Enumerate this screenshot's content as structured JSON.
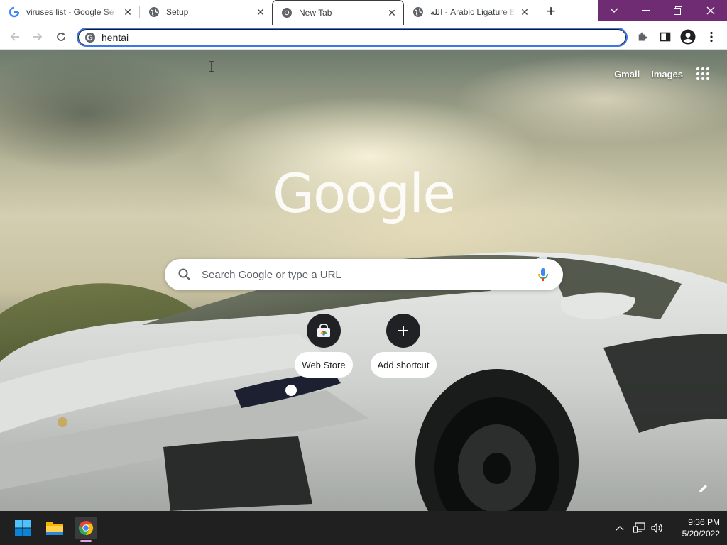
{
  "tabs": [
    {
      "title": "viruses list - Google Se",
      "favicon": "google-g-icon",
      "active": false
    },
    {
      "title": "Setup",
      "favicon": "globe-icon",
      "active": false
    },
    {
      "title": "New Tab",
      "favicon": "chrome-icon",
      "active": true
    },
    {
      "title": "الله - Arabic Ligature Bis",
      "favicon": "globe-icon",
      "active": false
    }
  ],
  "tab_close_glyph": "✕",
  "new_tab_glyph": "+",
  "window_controls": {
    "tab_search": "∨",
    "minimize": "—",
    "restore": "❐",
    "close": "✕"
  },
  "toolbar": {
    "omnibox_value": "hentai",
    "icons": [
      "back-icon",
      "forward-icon",
      "reload-icon",
      "extensions-icon",
      "side-panel-icon",
      "profile-icon",
      "menu-icon"
    ]
  },
  "ntp": {
    "gmail_label": "Gmail",
    "images_label": "Images",
    "logo_text": "Google",
    "search_placeholder": "Search Google or type a URL",
    "shortcuts": [
      {
        "label": "Web Store",
        "icon": "web-store-icon"
      },
      {
        "label": "Add shortcut",
        "icon": "plus-icon"
      }
    ]
  },
  "taskbar": {
    "time": "9:36 PM",
    "date": "5/20/2022",
    "icons": [
      "windows-start-icon",
      "file-explorer-icon",
      "chrome-icon"
    ],
    "tray_icons": [
      "chevron-up-icon",
      "network-icon",
      "volume-icon"
    ]
  },
  "colors": {
    "accent_purple": "#6f2c72",
    "omnibox_focus": "#3b78e7",
    "taskbar": "#202020"
  }
}
